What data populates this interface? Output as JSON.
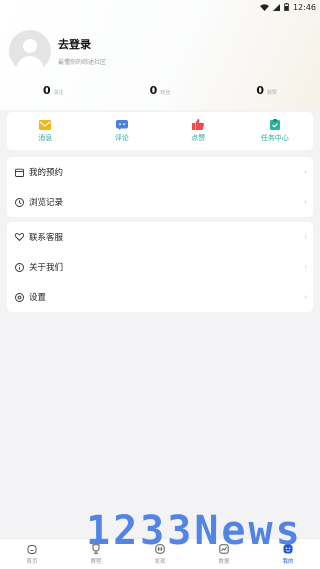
{
  "status_bar": {
    "time": "12:46"
  },
  "profile": {
    "login_label": "去登录",
    "subtitle": "最懂你的综述社区"
  },
  "stats": [
    {
      "value": "0",
      "label": "关注"
    },
    {
      "value": "0",
      "label": "粉丝"
    },
    {
      "value": "0",
      "label": "获赞"
    }
  ],
  "quick_actions": [
    {
      "label": "消息",
      "icon": "message-icon",
      "color": "#f3b51c"
    },
    {
      "label": "评论",
      "icon": "comment-icon",
      "color": "#4a7fe6"
    },
    {
      "label": "点赞",
      "icon": "like-icon",
      "color": "#ec4c4c"
    },
    {
      "label": "任务中心",
      "icon": "task-icon",
      "color": "#28b39c"
    }
  ],
  "menu_group_1": [
    {
      "label": "我的预约",
      "icon": "calendar-icon"
    },
    {
      "label": "浏览记录",
      "icon": "clock-icon"
    }
  ],
  "menu_group_2": [
    {
      "label": "联系客服",
      "icon": "heart-icon"
    },
    {
      "label": "关于我们",
      "icon": "info-icon"
    },
    {
      "label": "设置",
      "icon": "gear-icon"
    }
  ],
  "watermark": "1233News",
  "tabs": [
    {
      "label": "首页",
      "icon": "home-icon"
    },
    {
      "label": "赛程",
      "icon": "trophy-icon"
    },
    {
      "label": "发现",
      "icon": "discover-icon"
    },
    {
      "label": "数据",
      "icon": "chart-icon"
    },
    {
      "label": "我的",
      "icon": "profile-icon",
      "active": true
    }
  ],
  "colors": {
    "accent": "#1a56d6",
    "teal": "#2aa89a"
  }
}
